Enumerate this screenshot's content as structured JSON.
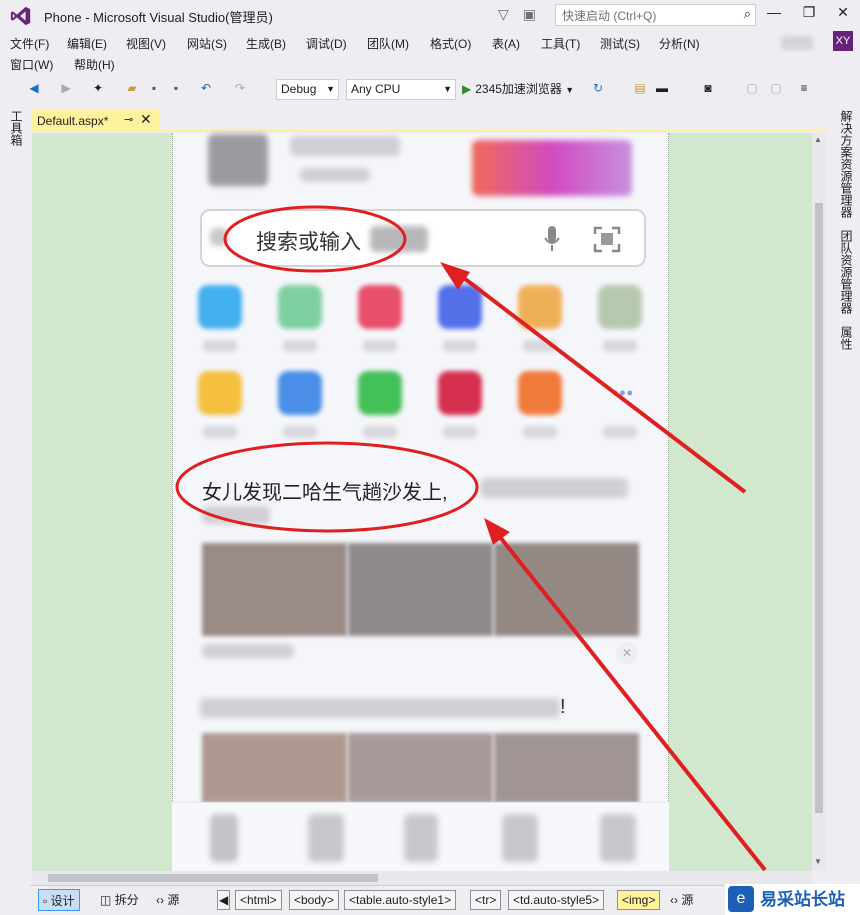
{
  "window": {
    "title": "Phone - Microsoft Visual Studio(管理员)",
    "quick_launch_placeholder": "快速启动 (Ctrl+Q)",
    "user_initials": "XY"
  },
  "menu": {
    "row1": [
      "文件(F)",
      "编辑(E)",
      "视图(V)",
      "网站(S)",
      "生成(B)",
      "调试(D)",
      "团队(M)",
      "格式(O)",
      "表(A)",
      "工具(T)",
      "测试(S)",
      "分析(N)"
    ],
    "row2": [
      "窗口(W)",
      "帮助(H)"
    ]
  },
  "toolbar": {
    "config": "Debug",
    "platform": "Any CPU",
    "run_target": "2345加速浏览器"
  },
  "left_rail": {
    "toolbox": "工具箱"
  },
  "right_rail": [
    "解决方案资源管理器",
    "团队资源管理器",
    "属性"
  ],
  "document_tab": {
    "label": "Default.aspx*"
  },
  "phone_page": {
    "search_placeholder": "搜索或输入",
    "headline1": "女儿发现二哈生气趟沙发上,",
    "headline2_end": "!",
    "more_glyph": "•••"
  },
  "viewbar": {
    "design": "设计",
    "split": "拆分",
    "source": "源",
    "breadcrumbs": [
      "<html>",
      "<body>",
      "<table.auto-style1>",
      "<tr>",
      "<td.auto-style5>",
      "<img>"
    ],
    "source2": "源"
  },
  "watermark": {
    "text": "易采站长站"
  }
}
